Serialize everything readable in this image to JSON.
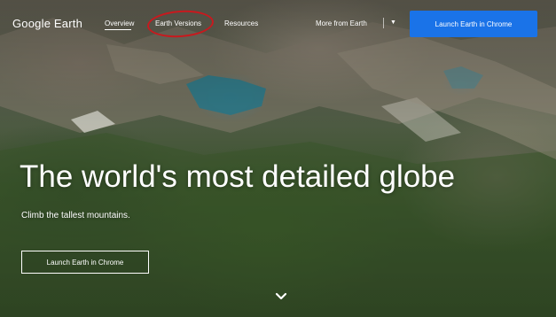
{
  "header": {
    "logo_text": "Google Earth",
    "nav": {
      "overview": "Overview",
      "earth_versions": "Earth Versions",
      "resources": "Resources",
      "more_from_earth": "More from Earth"
    },
    "cta_label": "Launch Earth in Chrome"
  },
  "hero": {
    "headline": "The world's most detailed globe",
    "subhead": "Climb the tallest mountains.",
    "cta_label": "Launch Earth in Chrome"
  },
  "icons": {
    "more_menu": "chevron-down-icon",
    "scroll": "chevron-down-icon"
  },
  "colors": {
    "primary_button": "#1a73e8",
    "annotation": "#c8191e",
    "text": "#ffffff"
  }
}
